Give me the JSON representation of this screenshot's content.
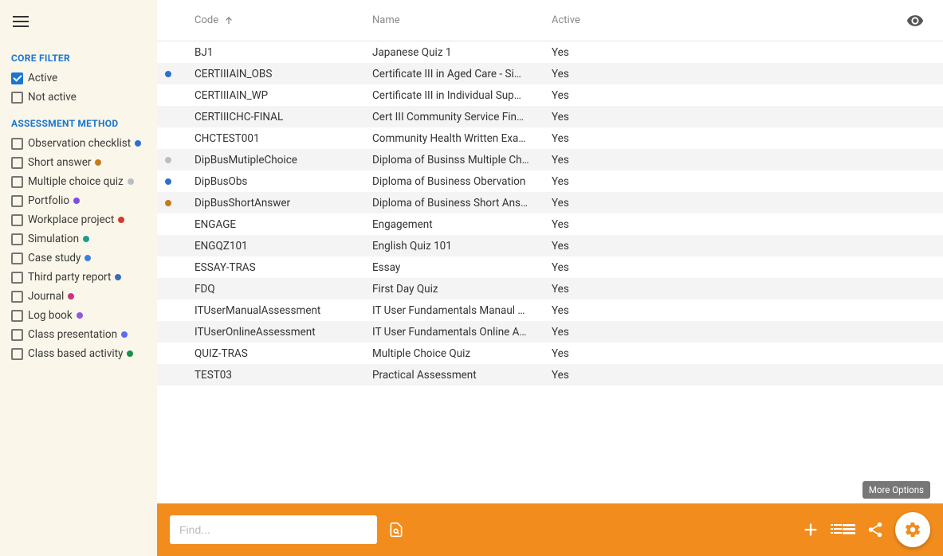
{
  "sidebar": {
    "core_filter_heading": "CORE FILTER",
    "core_filters": [
      {
        "label": "Active",
        "checked": true
      },
      {
        "label": "Not active",
        "checked": false
      }
    ],
    "method_heading": "ASSESSMENT METHOD",
    "methods": [
      {
        "label": "Observation checklist",
        "color": "#2B6FD0"
      },
      {
        "label": "Short answer",
        "color": "#C67A1A"
      },
      {
        "label": "Multiple choice quiz",
        "color": "#B7BEC6"
      },
      {
        "label": "Portfolio",
        "color": "#7B4FE0"
      },
      {
        "label": "Workplace project",
        "color": "#D33A2F"
      },
      {
        "label": "Simulation",
        "color": "#1E9B8E"
      },
      {
        "label": "Case study",
        "color": "#3A7FE2"
      },
      {
        "label": "Third party report",
        "color": "#3A6CB5"
      },
      {
        "label": "Journal",
        "color": "#C5377F"
      },
      {
        "label": "Log book",
        "color": "#8E5AE0"
      },
      {
        "label": "Class presentation",
        "color": "#5A6FF2"
      },
      {
        "label": "Class based activity",
        "color": "#1B8F4E"
      }
    ]
  },
  "table": {
    "headers": {
      "code": "Code",
      "name": "Name",
      "active": "Active"
    },
    "rows": [
      {
        "code": "BJ1",
        "name": "Japanese Quiz 1",
        "active": "Yes",
        "dot": null
      },
      {
        "code": "CERTIIIAIN_OBS",
        "name": "Certificate III in Aged Care - Si…",
        "active": "Yes",
        "dot": "#2B6FD0"
      },
      {
        "code": "CERTIIIAIN_WP",
        "name": "Certificate III in Individual Sup…",
        "active": "Yes",
        "dot": null
      },
      {
        "code": "CERTIIICHC-FINAL",
        "name": "Cert III Community Service Fin…",
        "active": "Yes",
        "dot": null
      },
      {
        "code": "CHCTEST001",
        "name": "Community Health Written Exa…",
        "active": "Yes",
        "dot": null
      },
      {
        "code": "DipBusMutipleChoice",
        "name": "Diploma of Businss Multiple Ch…",
        "active": "Yes",
        "dot": "#B7BEC6"
      },
      {
        "code": "DipBusObs",
        "name": "Diploma of Business Obervation",
        "active": "Yes",
        "dot": "#2B6FD0"
      },
      {
        "code": "DipBusShortAnswer",
        "name": "Diploma of Business Short Ans…",
        "active": "Yes",
        "dot": "#C67A1A"
      },
      {
        "code": "ENGAGE",
        "name": "Engagement",
        "active": "Yes",
        "dot": null
      },
      {
        "code": "ENGQZ101",
        "name": "English Quiz 101",
        "active": "Yes",
        "dot": null
      },
      {
        "code": "ESSAY-TRAS",
        "name": "Essay",
        "active": "Yes",
        "dot": null
      },
      {
        "code": "FDQ",
        "name": "First Day Quiz",
        "active": "Yes",
        "dot": null
      },
      {
        "code": "ITUserManualAssessment",
        "name": "IT User Fundamentals Manaul …",
        "active": "Yes",
        "dot": null
      },
      {
        "code": "ITUserOnlineAssessment",
        "name": "IT User Fundamentals Online A…",
        "active": "Yes",
        "dot": null
      },
      {
        "code": "QUIZ-TRAS",
        "name": "Multiple Choice Quiz",
        "active": "Yes",
        "dot": null
      },
      {
        "code": "TEST03",
        "name": "Practical Assessment",
        "active": "Yes",
        "dot": null
      }
    ]
  },
  "tooltip": "More Options",
  "search": {
    "placeholder": "Find..."
  }
}
